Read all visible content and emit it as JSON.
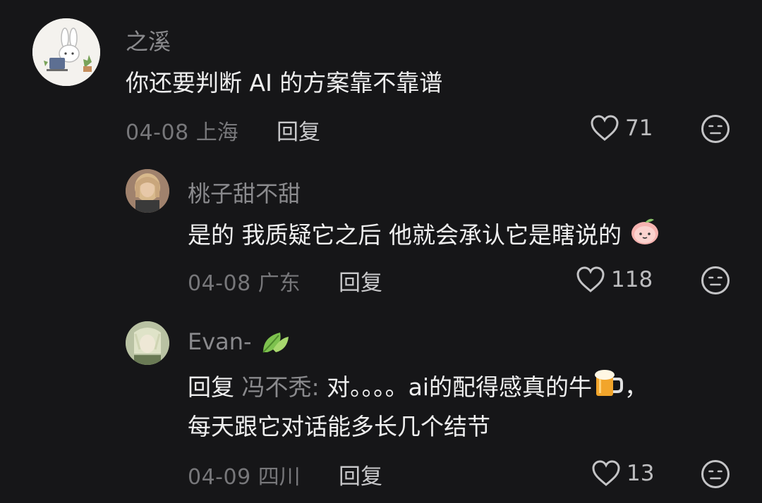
{
  "comments": [
    {
      "username": "之溪",
      "text": "你还要判断 AI 的方案靠不靠谱",
      "date": "04-08",
      "location": "上海",
      "reply_label": "回复",
      "likes": "71"
    },
    {
      "username": "桃子甜不甜",
      "text": "是的 我质疑它之后 他就会承认它是瞎说的",
      "date": "04-08",
      "location": "广东",
      "reply_label": "回复",
      "likes": "118"
    },
    {
      "username": "Evan-",
      "reply_prefix": "回复",
      "reply_target": "冯不秃:",
      "text_line1": " 对。。。。ai的配得感真的牛",
      "text_line1_tail": "，",
      "text_line2": "每天跟它对话能多长几个结节",
      "date": "04-09",
      "location": "四川",
      "reply_label": "回复",
      "likes": "13"
    }
  ],
  "icons": {
    "like": "heart-outline-icon",
    "dislike": "meh-face-icon",
    "emoji_peach": "peach-emoji-icon",
    "emoji_beer": "beer-mug-emoji-icon",
    "emoji_leaf": "leaf-emoji-icon"
  },
  "colors": {
    "background": "#161618",
    "primary_text": "#efefef",
    "secondary_text": "#8a8a8d",
    "meta_text": "#77777a"
  }
}
